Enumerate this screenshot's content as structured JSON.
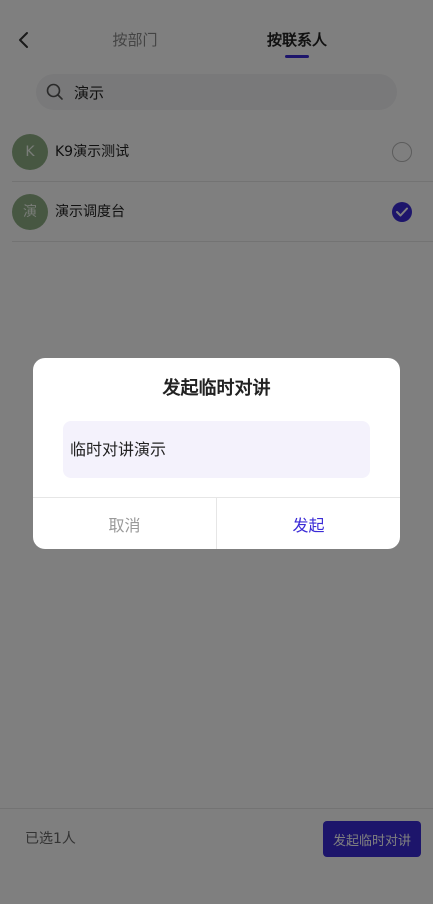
{
  "header": {
    "back_icon": "chevron-left-icon",
    "tabs": [
      {
        "label": "按部门",
        "active": false
      },
      {
        "label": "按联系人",
        "active": true
      }
    ]
  },
  "search": {
    "icon": "search-icon",
    "value": "演示",
    "placeholder": ""
  },
  "contacts": [
    {
      "avatar_text": "K",
      "name": "K9演示测试",
      "selected": false
    },
    {
      "avatar_text": "演",
      "name": "演示调度台",
      "selected": true
    }
  ],
  "footer": {
    "selected_text": "已选1人",
    "start_button_label": "发起临时对讲"
  },
  "dialog": {
    "title": "发起临时对讲",
    "input_value": "临时对讲演示",
    "cancel_label": "取消",
    "confirm_label": "发起"
  },
  "colors": {
    "accent": "#3b2bd6",
    "avatar": "#8faf85",
    "overlay": "rgba(0,0,0,0.5)"
  }
}
